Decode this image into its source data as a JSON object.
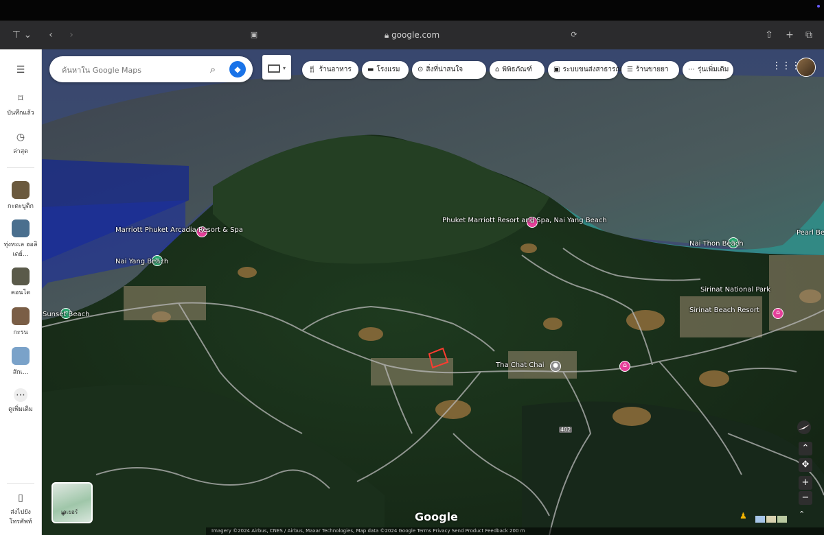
{
  "browser": {
    "url": "google.com",
    "sidebar_toggle_icon": "sidebar-icon",
    "back_icon": "chevron-left-icon",
    "forward_icon": "chevron-right-icon",
    "share_icon": "share-icon",
    "newtab_icon": "plus-icon",
    "tabs_icon": "tabs-icon"
  },
  "search": {
    "placeholder": "ค้นหาใน Google Maps",
    "search_icon": "search-icon",
    "directions_icon": "directions-icon"
  },
  "chips": [
    {
      "icon": "restaurant-icon",
      "label": "ร้านอาหาร"
    },
    {
      "icon": "hotel-icon",
      "label": "โรงแรม"
    },
    {
      "icon": "attraction-icon",
      "label": "สิ่งที่น่าสนใจ"
    },
    {
      "icon": "museum-icon",
      "label": "พิพิธภัณฑ์"
    },
    {
      "icon": "transit-icon",
      "label": "ระบบขนส่งสาธารณะ"
    },
    {
      "icon": "pharmacy-icon",
      "label": "ร้านขายยา"
    },
    {
      "icon": "more-icon",
      "label": "รุ่นเพิ่มเติม"
    }
  ],
  "rail": {
    "menu_icon": "hamburger-icon",
    "items": [
      {
        "icon": "bookmark-icon",
        "label": "บันทึกแล้ว"
      },
      {
        "icon": "history-icon",
        "label": "ล่าสุด"
      },
      {
        "label": "กะตะบูติก",
        "thumb_color": "#6b5a3e"
      },
      {
        "label": "ทุ่งทะเล ฮอลิเดย์...",
        "thumb_color": "#4a6f8e"
      },
      {
        "label": "คอนโด",
        "thumb_color": "#5a5a4a"
      },
      {
        "label": "กะรน",
        "thumb_color": "#7a5e46"
      },
      {
        "label": "สักเ...",
        "thumb_color": "#7aa2c9"
      },
      {
        "icon": "more-icon",
        "label": "ดูเพิ่มเติม"
      }
    ],
    "bottom": {
      "icon": "phone-icon",
      "label": "ส่งไปยังโทรศัพท์"
    }
  },
  "map": {
    "places": [
      {
        "name": "Phuket Marriott Resort and Spa, Nai Yang Beach",
        "type": "hotel"
      },
      {
        "name": "Marriott Phuket Arcadia Resort & Spa",
        "type": "hotel"
      },
      {
        "name": "Nai Yang Beach",
        "type": "beach"
      },
      {
        "name": "Sunset Beach",
        "type": "beach"
      },
      {
        "name": "Nai Thon Beach",
        "type": "beach"
      },
      {
        "name": "Pearl Beach",
        "type": "beach"
      },
      {
        "name": "Sirinat National Park",
        "type": "park"
      },
      {
        "name": "Sirinat Beach Resort",
        "type": "hotel"
      },
      {
        "name": "Tha Chat Chai",
        "type": "place"
      }
    ],
    "route_shield": "402",
    "watermark": "Google",
    "attribution": "Imagery ©2024 Airbus, CNES / Airbus, Maxar Technologies, Map data ©2024 Google   Terms   Privacy   Send Product Feedback   200 m"
  },
  "layers": {
    "label": "เลเยอร์",
    "icon": "layers-icon"
  },
  "controls": {
    "compass_icon": "compass-icon",
    "tilt_icon": "tilt-icon",
    "rotate_icon": "rotate-icon",
    "zoom_in": "+",
    "zoom_out": "−",
    "pegman_icon": "pegman-icon",
    "expand_icon": "expand-icon"
  },
  "colors": {
    "hotel_pin": "#e6409a",
    "beach_pin": "#2aa870",
    "directions": "#1a73e8"
  }
}
